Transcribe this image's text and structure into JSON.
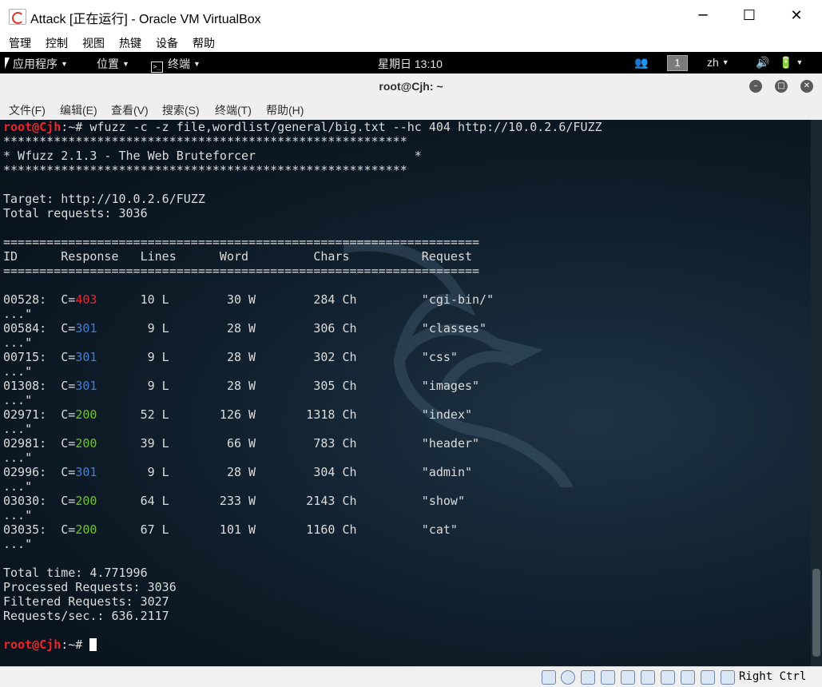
{
  "host": {
    "title": "Attack [正在运行] - Oracle VM VirtualBox",
    "minimize": "─",
    "maximize": "☐",
    "close": "✕",
    "menu": [
      "管理",
      "控制",
      "视图",
      "热键",
      "设备",
      "帮助"
    ]
  },
  "gnome_panel": {
    "apps": "应用程序",
    "places": "位置",
    "terminal": "终端",
    "clock": "星期日 13:10",
    "workspace": "1",
    "lang": "zh"
  },
  "terminal": {
    "title": "root@Cjh: ~",
    "menu": [
      "文件(F)",
      "编辑(E)",
      "查看(V)",
      "搜索(S)",
      "终端(T)",
      "帮助(H)"
    ],
    "prompt_user": "root@Cjh",
    "prompt_rest": ":~# ",
    "command": "wfuzz -c -z file,wordlist/general/big.txt --hc 404 http://10.0.2.6/FUZZ",
    "stars": "********************************************************",
    "banner": "* Wfuzz 2.1.3 - The Web Bruteforcer                      *",
    "target": "Target: http://10.0.2.6/FUZZ",
    "total_requests": "Total requests: 3036",
    "separator": "==================================================================",
    "header": "ID\tResponse   Lines      Word         Chars          Request",
    "results": [
      {
        "id": "00528",
        "code": "403",
        "lines": "10 L",
        "words": "30 W",
        "chars": "284 Ch",
        "req": "\"cgi-bin/\""
      },
      {
        "id": "00584",
        "code": "301",
        "lines": "9 L",
        "words": "28 W",
        "chars": "306 Ch",
        "req": "\"classes\""
      },
      {
        "id": "00715",
        "code": "301",
        "lines": "9 L",
        "words": "28 W",
        "chars": "302 Ch",
        "req": "\"css\""
      },
      {
        "id": "01308",
        "code": "301",
        "lines": "9 L",
        "words": "28 W",
        "chars": "305 Ch",
        "req": "\"images\""
      },
      {
        "id": "02971",
        "code": "200",
        "lines": "52 L",
        "words": "126 W",
        "chars": "1318 Ch",
        "req": "\"index\""
      },
      {
        "id": "02981",
        "code": "200",
        "lines": "39 L",
        "words": "66 W",
        "chars": "783 Ch",
        "req": "\"header\""
      },
      {
        "id": "02996",
        "code": "301",
        "lines": "9 L",
        "words": "28 W",
        "chars": "304 Ch",
        "req": "\"admin\""
      },
      {
        "id": "03030",
        "code": "200",
        "lines": "64 L",
        "words": "233 W",
        "chars": "2143 Ch",
        "req": "\"show\""
      },
      {
        "id": "03035",
        "code": "200",
        "lines": "67 L",
        "words": "101 W",
        "chars": "1160 Ch",
        "req": "\"cat\""
      }
    ],
    "ellipsis": "...\"",
    "total_time": "Total time: 4.771996",
    "processed": "Processed Requests: 3036",
    "filtered": "Filtered Requests: 3027",
    "rate": "Requests/sec.: 636.2117",
    "final_prompt_user": "root@Cjh",
    "final_prompt_rest": ":~# "
  },
  "statusbar": {
    "host_key": "Right Ctrl"
  },
  "colors": {
    "prompt": "#e8262b",
    "code_200": "#6ac71a",
    "code_301": "#3f7ed8",
    "code_403": "#e8262b"
  }
}
